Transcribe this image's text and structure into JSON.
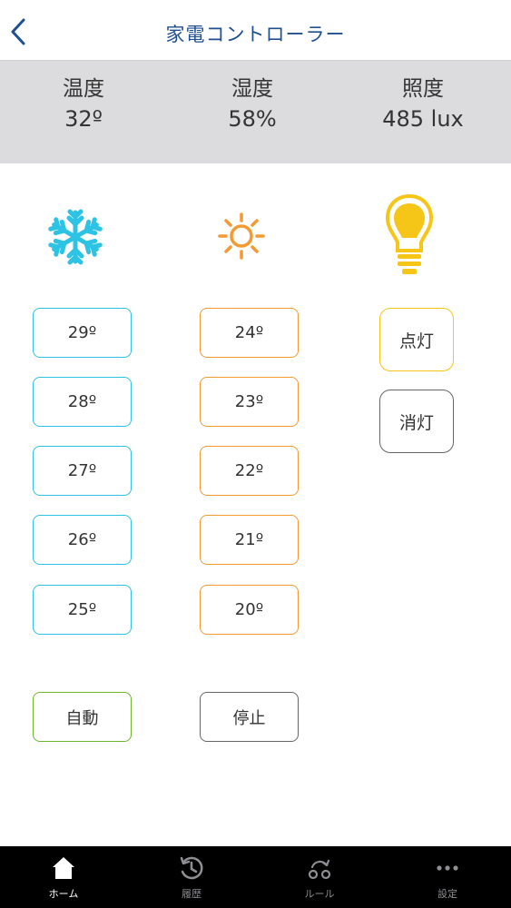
{
  "header": {
    "title": "家電コントローラー"
  },
  "sensors": [
    {
      "label": "温度",
      "value": "32º"
    },
    {
      "label": "湿度",
      "value": "58%"
    },
    {
      "label": "照度",
      "value": "485 lux"
    }
  ],
  "icons": {
    "back": "chevron-left-icon",
    "cool": "snowflake-icon",
    "heat": "sun-icon",
    "light": "light-bulb-icon"
  },
  "cooling": {
    "temps": [
      "29º",
      "28º",
      "27º",
      "26º",
      "25º"
    ],
    "auto_label": "自動"
  },
  "heating": {
    "temps": [
      "24º",
      "23º",
      "22º",
      "21º",
      "20º"
    ],
    "stop_label": "停止"
  },
  "light": {
    "on_label": "点灯",
    "off_label": "消灯"
  },
  "tabs": [
    {
      "label": "ホーム",
      "icon": "home-icon",
      "active": true
    },
    {
      "label": "履歴",
      "icon": "history-icon",
      "active": false
    },
    {
      "label": "ルール",
      "icon": "rule-icon",
      "active": false
    },
    {
      "label": "設定",
      "icon": "more-icon",
      "active": false
    }
  ],
  "colors": {
    "accent": "#1f4f8f",
    "cool": "#2cc3e5",
    "heat": "#f39a33",
    "light_on": "#f5c518",
    "auto": "#6cb52f",
    "stop": "#666666"
  }
}
